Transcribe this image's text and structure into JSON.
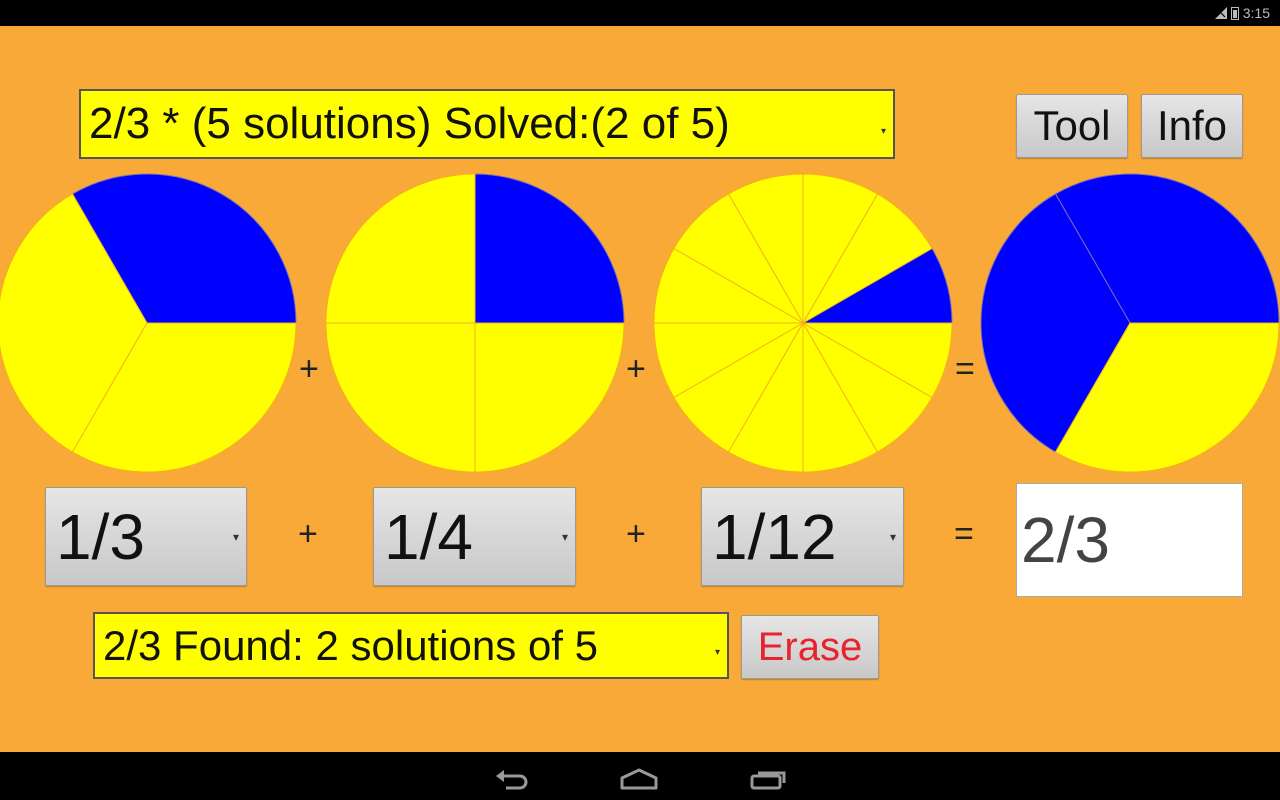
{
  "status_bar": {
    "time": "3:15",
    "icons": [
      "signal-icon",
      "battery-icon"
    ]
  },
  "problem_selector": {
    "label": "2/3 * (5 solutions) Solved:(2 of 5)",
    "caret": "▾"
  },
  "toolbar": {
    "tool_label": "Tool",
    "info_label": "Info"
  },
  "colors": {
    "background": "#f9a937",
    "shaded": "#0000ff",
    "unshaded": "#ffff00",
    "divider": "#f2b418",
    "erase_text": "#e8232e"
  },
  "equation": {
    "operators": [
      "+",
      "+",
      "="
    ],
    "terms": [
      {
        "label": "1/3",
        "numerator": 1,
        "denominator": 3
      },
      {
        "label": "1/4",
        "numerator": 1,
        "denominator": 4
      },
      {
        "label": "1/12",
        "numerator": 1,
        "denominator": 12
      }
    ],
    "result": {
      "label": "2/3",
      "numerator": 2,
      "denominator": 3
    }
  },
  "pies": [
    {
      "name": "pie-one-third",
      "shaded": 1,
      "slices": 3
    },
    {
      "name": "pie-one-quarter",
      "shaded": 1,
      "slices": 4
    },
    {
      "name": "pie-one-twelfth",
      "shaded": 1,
      "slices": 12
    },
    {
      "name": "pie-two-thirds",
      "shaded": 2,
      "slices": 3
    }
  ],
  "found_selector": {
    "label": "2/3 Found: 2 solutions of 5",
    "caret": "▾"
  },
  "erase_label": "Erase",
  "nav_bar": {
    "buttons": [
      "back",
      "home",
      "recent-apps"
    ]
  }
}
